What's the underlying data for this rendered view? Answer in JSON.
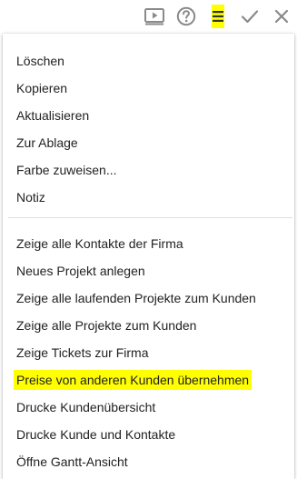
{
  "toolbar": {
    "buttons": [
      {
        "icon": "play-screen-icon"
      },
      {
        "icon": "help-circle-icon"
      },
      {
        "icon": "hamburger-menu-icon",
        "highlight": "#ffff00"
      },
      {
        "icon": "checkmark-icon"
      },
      {
        "icon": "close-icon"
      }
    ],
    "icon_color": "#8a8a8a",
    "active_icon_color": "#333333"
  },
  "menu": {
    "group1": [
      "Löschen",
      "Kopieren",
      "Aktualisieren",
      "Zur Ablage",
      "Farbe zuweisen...",
      "Notiz"
    ],
    "group2": [
      "Zeige alle Kontakte der Firma",
      "Neues Projekt anlegen",
      "Zeige alle laufenden Projekte zum Kunden",
      "Zeige alle Projekte zum Kunden",
      "Zeige Tickets zur Firma",
      "Preise von anderen Kunden übernehmen",
      "Drucke Kundenübersicht",
      "Drucke Kunde und Kontakte",
      "Öffne Gantt-Ansicht"
    ],
    "highlighted_item": "Preise von anderen Kunden übernehmen",
    "highlight_color": "#ffff00"
  }
}
